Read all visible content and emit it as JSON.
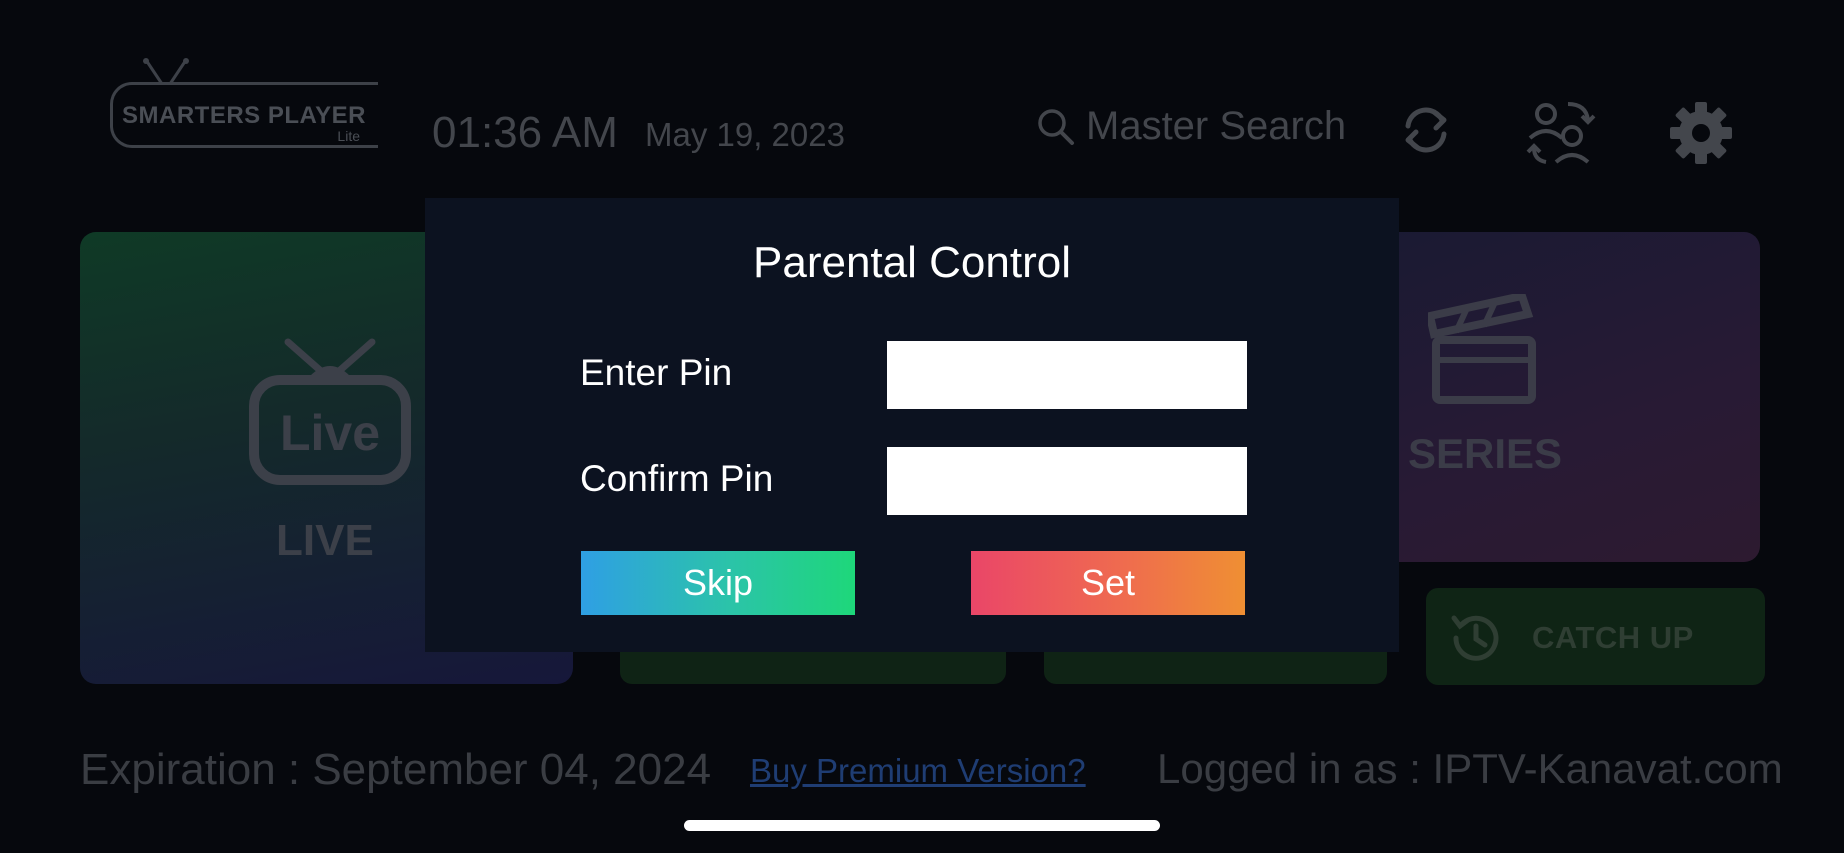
{
  "header": {
    "logo_text": "SMARTERS PLAYER",
    "logo_sub": "Lite",
    "time": "01:36 AM",
    "date": "May 19, 2023",
    "search_label": "Master Search",
    "icons": [
      "search-icon",
      "refresh-icon",
      "switch-user-icon",
      "gear-icon"
    ]
  },
  "tiles": {
    "live_label": "LIVE",
    "live_icon_text": "Live",
    "series_label": "SERIES",
    "catchup_label": "CATCH UP"
  },
  "dialog": {
    "title": "Parental Control",
    "enter_pin_label": "Enter Pin",
    "enter_pin_value": "",
    "confirm_pin_label": "Confirm Pin",
    "confirm_pin_value": "",
    "skip_label": "Skip",
    "set_label": "Set"
  },
  "footer": {
    "expiration": "Expiration : September 04, 2024",
    "buy_link": "Buy Premium Version?",
    "logged_in": "Logged in as : IPTV-Kanavat.com"
  },
  "colors": {
    "skip_gradient": [
      "#2f9fe4",
      "#1ed77a"
    ],
    "set_gradient": [
      "#ea4668",
      "#ef8f33"
    ],
    "dialog_bg": "#0c1220"
  }
}
